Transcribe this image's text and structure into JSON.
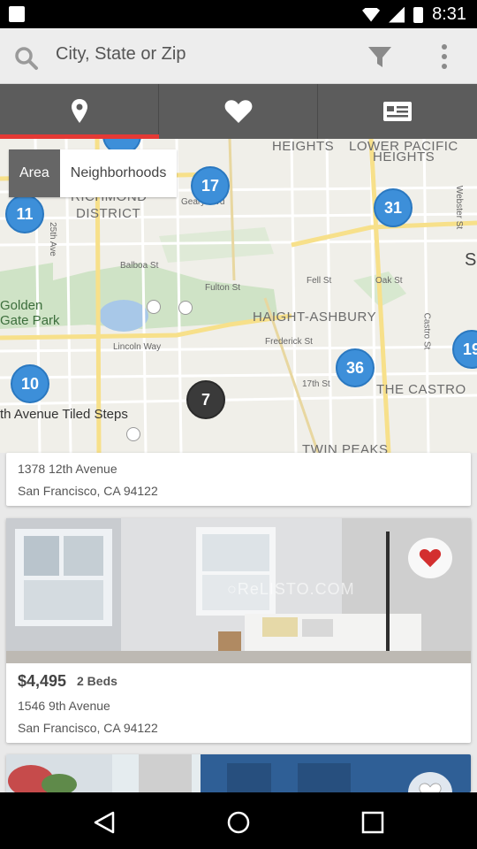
{
  "status_bar": {
    "time": "8:31"
  },
  "search": {
    "placeholder": "City, State or Zip"
  },
  "tabs": [
    {
      "name": "map-tab",
      "icon": "location-pin-icon",
      "active": true
    },
    {
      "name": "favorites-tab",
      "icon": "heart-icon",
      "active": false
    },
    {
      "name": "list-tab",
      "icon": "list-card-icon",
      "active": false
    }
  ],
  "map": {
    "toggle": {
      "area_label": "Area",
      "neighborhoods_label": "Neighborhoods"
    },
    "clusters": [
      "17",
      "11",
      "31",
      "10",
      "7",
      "36",
      "19"
    ],
    "labels": {
      "richmond": "RICHMOND",
      "district": "DISTRICT",
      "heights": "HEIGHTS",
      "lower_pacific": "LOWER PACIFIC",
      "lower_pacific_heights": "HEIGHTS",
      "golden_gate_1": "Golden",
      "golden_gate_2": "Gate Park",
      "haight_ashbury": "HAIGHT-ASHBURY",
      "the_castro": "THE CASTRO",
      "twin_peaks": "TWIN PEAKS",
      "tiled_steps": "th Avenue Tiled Steps",
      "balboa": "Balboa St",
      "fulton": "Fulton St",
      "lincoln": "Lincoln Way",
      "frederick": "Frederick St",
      "fell": "Fell St",
      "oak": "Oak St",
      "seventeenth": "17th St",
      "geary": "Geary Blvd",
      "castro_st": "Castro St",
      "webster": "Webster St",
      "twenty_fifth": "25th Ave",
      "s_edge": "S"
    }
  },
  "listings": [
    {
      "address_line1": "1378 12th Avenue",
      "address_line2": "San Francisco, CA 94122"
    },
    {
      "price": "$4,495",
      "beds": "2 Beds",
      "address_line1": "1546 9th Avenue",
      "address_line2": "San Francisco, CA 94122",
      "favorited": true,
      "watermark": "○ReLISTO.COM"
    },
    {
      "favorited": false
    }
  ],
  "colors": {
    "accent": "#e53935",
    "cluster_blue": "#3d8fd9",
    "tabbar": "#5c5c5c"
  }
}
